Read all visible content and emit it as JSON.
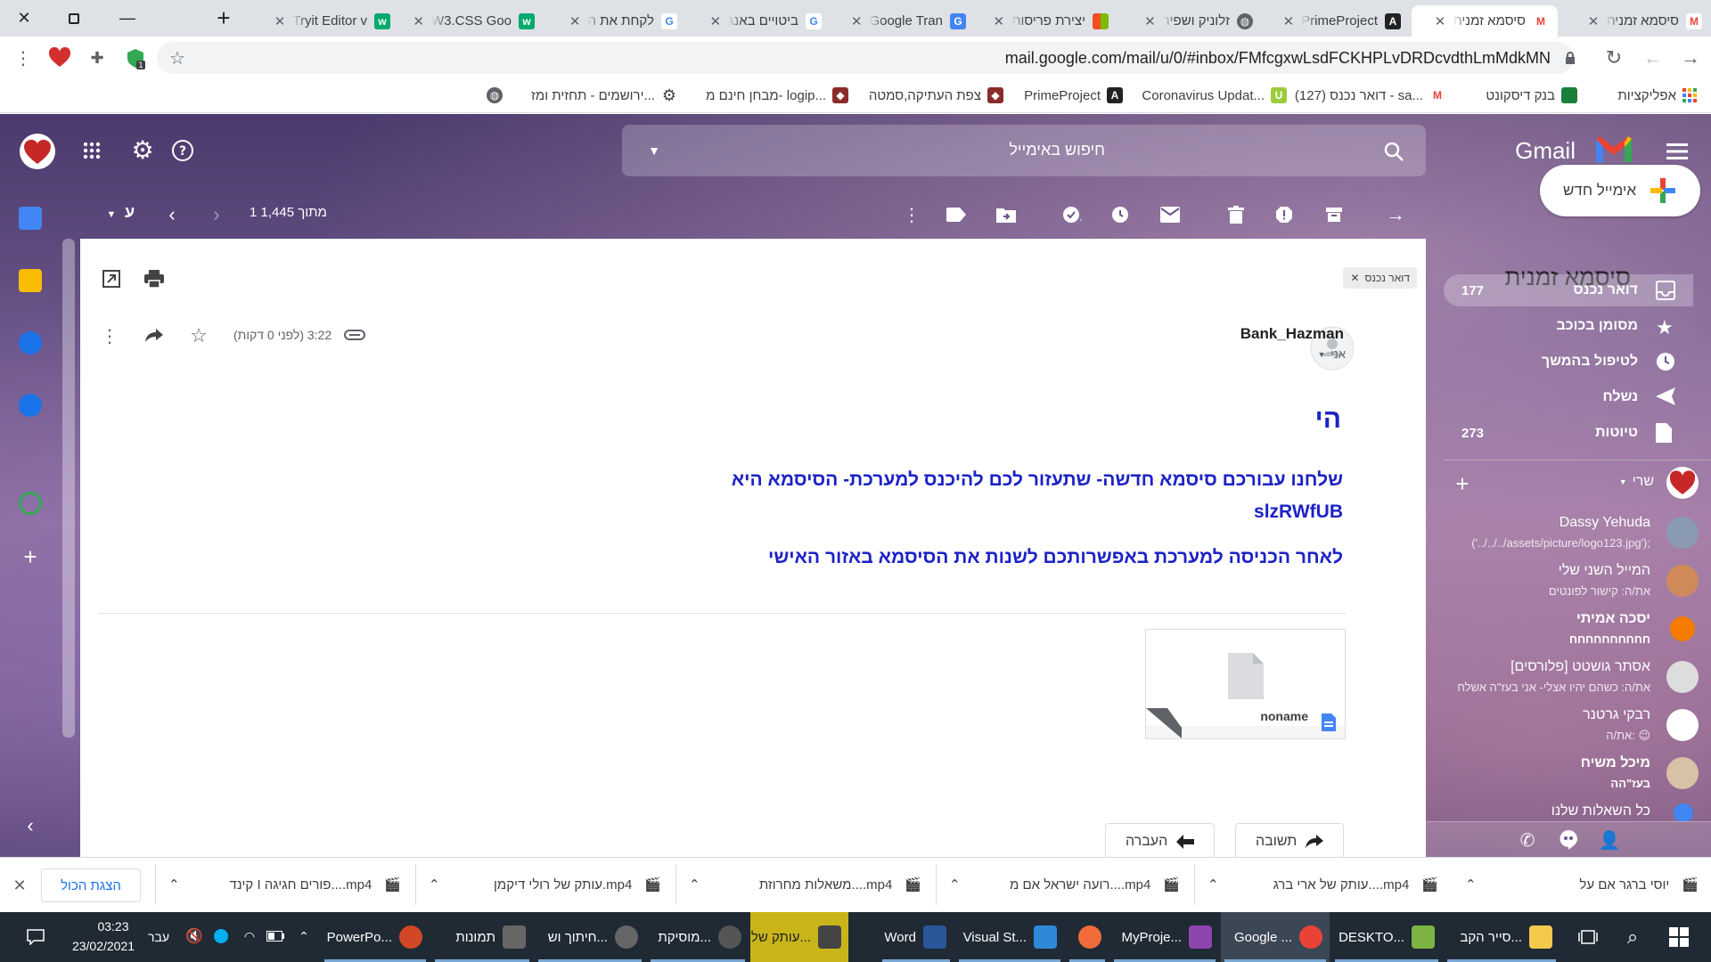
{
  "browser": {
    "tabs": [
      {
        "title": "סיסמא זמנית",
        "favicon": "gmail-icon",
        "active": false
      },
      {
        "title": "סיסמא זמנית",
        "favicon": "gmail-icon",
        "active": true
      },
      {
        "title": "PrimeProject",
        "favicon": "angular-icon",
        "active": false
      },
      {
        "title": "זלוניק ושפיר",
        "favicon": "globe-icon",
        "active": false
      },
      {
        "title": "יצירת פריסות",
        "favicon": "microsoft-icon",
        "active": false
      },
      {
        "title": "Google Tran",
        "favicon": "translate-icon",
        "active": false
      },
      {
        "title": "ביטויים באנג",
        "favicon": "google-icon",
        "active": false
      },
      {
        "title": "לקחת את ה",
        "favicon": "google-icon",
        "active": false
      },
      {
        "title": "W3.CSS Goo",
        "favicon": "w3-icon",
        "active": false
      },
      {
        "title": "Tryit Editor v",
        "favicon": "w3-icon",
        "active": false
      }
    ],
    "url": "mail.google.com/mail/u/0/#inbox/FMfcgxwLsdFCKHPLvDRDcvdthLmMdkMN",
    "bookmarks": [
      {
        "label": "אפליקציות",
        "icon": "apps-icon"
      },
      {
        "label": "בנק דיסקונט",
        "icon": "bank-icon"
      },
      {
        "label": "דואר נכנס (127) - sa...",
        "icon": "gmail-icon"
      },
      {
        "label": "Coronavirus Updat...",
        "icon": "corona-icon"
      },
      {
        "label": "PrimeProject",
        "icon": "angular-icon"
      },
      {
        "label": "צפת העתיקה,סמטה",
        "icon": "shield-icon"
      },
      {
        "label": "מבחן חינם מ- logip...",
        "icon": "shield-icon"
      },
      {
        "label": "ירושמים - תחזית ומז...",
        "icon": "gear-icon"
      },
      {
        "label": "",
        "icon": "globe-icon"
      }
    ]
  },
  "gmail": {
    "brand": "Gmail",
    "search_placeholder": "חיפוש באימייל",
    "pagination": "1 מתוך 1,445",
    "lang_label": "ע",
    "compose_label": "אימייל חדש",
    "nav": [
      {
        "label": "דואר נכנס",
        "count": "177",
        "icon": "inbox-icon",
        "active": true
      },
      {
        "label": "מסומן בכוכב",
        "count": "",
        "icon": "star-icon",
        "active": false
      },
      {
        "label": "לטיפול בהמשך",
        "count": "",
        "icon": "clock-icon",
        "active": false
      },
      {
        "label": "נשלח",
        "count": "",
        "icon": "send-icon",
        "active": false
      },
      {
        "label": "טיוטות",
        "count": "273",
        "icon": "draft-icon",
        "active": false
      }
    ],
    "hangouts_user": "שרי",
    "hangouts": [
      {
        "name": "Dassy Yehuda",
        "snippet": "('../../../assets/picture/logo123.jpg');",
        "color": "#8a9ab0"
      },
      {
        "name": "המייל השני שלי",
        "snippet": "את/ה: קישור לפונטים",
        "color": "#d08a5a"
      },
      {
        "name": "יסכה אמיתי",
        "snippet": "חחחחחחחחחח",
        "color": "#f57c00"
      },
      {
        "name": "אסתר גושטט [פלורסים]",
        "snippet": "את/ה: כשהם יהיו אצלי- אני בעז\"ה אשלח",
        "color": "#dddddd"
      },
      {
        "name": "רבקי גרטנר",
        "snippet": "את/ה: 😉",
        "color": "#ffffff"
      },
      {
        "name": "מיכל משיח",
        "snippet": "בעז\"הה",
        "color": "#d7c2a8"
      },
      {
        "name": "כל השאלות שלנו",
        "snippet": "",
        "color": "#4285f4"
      }
    ],
    "message": {
      "subject": "סיסמא זמנית",
      "label": "דואר נכנס",
      "sender": "Bank_Hazman",
      "to": "אני",
      "time": "3:22 (לפני 0 דקות)",
      "greeting": "הי",
      "line1": "שלחנו עבורכם סיסמא חדשה- שתעזור לכם להיכנס למערכת- הסיסמא היא slzRWfUB",
      "line2": "לאחר הכניסה למערכת באפשרותכם לשנות את הסיסמא באזור האישי",
      "attachment": "noname",
      "reply_label": "תשובה",
      "forward_label": "העברה"
    }
  },
  "downloads": {
    "items": [
      "יוסי ברגר אם על",
      "עותק של ארי ברג....mp4",
      "רועה ישראל אם מ....mp4",
      "משאלות מחרוזת....mp4",
      "עותק של רולי דיקמן.mp4",
      "קינד I פורים חגיגה....mp4"
    ],
    "show_all": "הצגת הכול"
  },
  "taskbar": {
    "time": "03:23",
    "date": "23/02/2021",
    "lang": "עבר",
    "apps": [
      {
        "label": "סייר הקב...",
        "color": "#f2c94c"
      },
      {
        "label": "DESKTO...",
        "color": "#7cb342"
      },
      {
        "label": "Google ...",
        "color": "#ea4335"
      },
      {
        "label": "MyProje...",
        "color": "#8e44ad"
      },
      {
        "label": "",
        "color": "#f26b3a"
      },
      {
        "label": "Visual St...",
        "color": "#2e8ad8"
      },
      {
        "label": "Word",
        "color": "#2b579a"
      },
      {
        "label": "עותק של...",
        "color": "#444444"
      },
      {
        "label": "מוסיקת...",
        "color": "#555555"
      },
      {
        "label": "חיתוך וש...",
        "color": "#666666"
      },
      {
        "label": "תמונות",
        "color": "#666666"
      },
      {
        "label": "PowerPo...",
        "color": "#d24726"
      }
    ]
  },
  "colors": {
    "email_blue": "#1c22c7",
    "gmail_purple": "#6a5488",
    "taskbar": "#1f2a34",
    "link_blue": "#1a73e8"
  }
}
